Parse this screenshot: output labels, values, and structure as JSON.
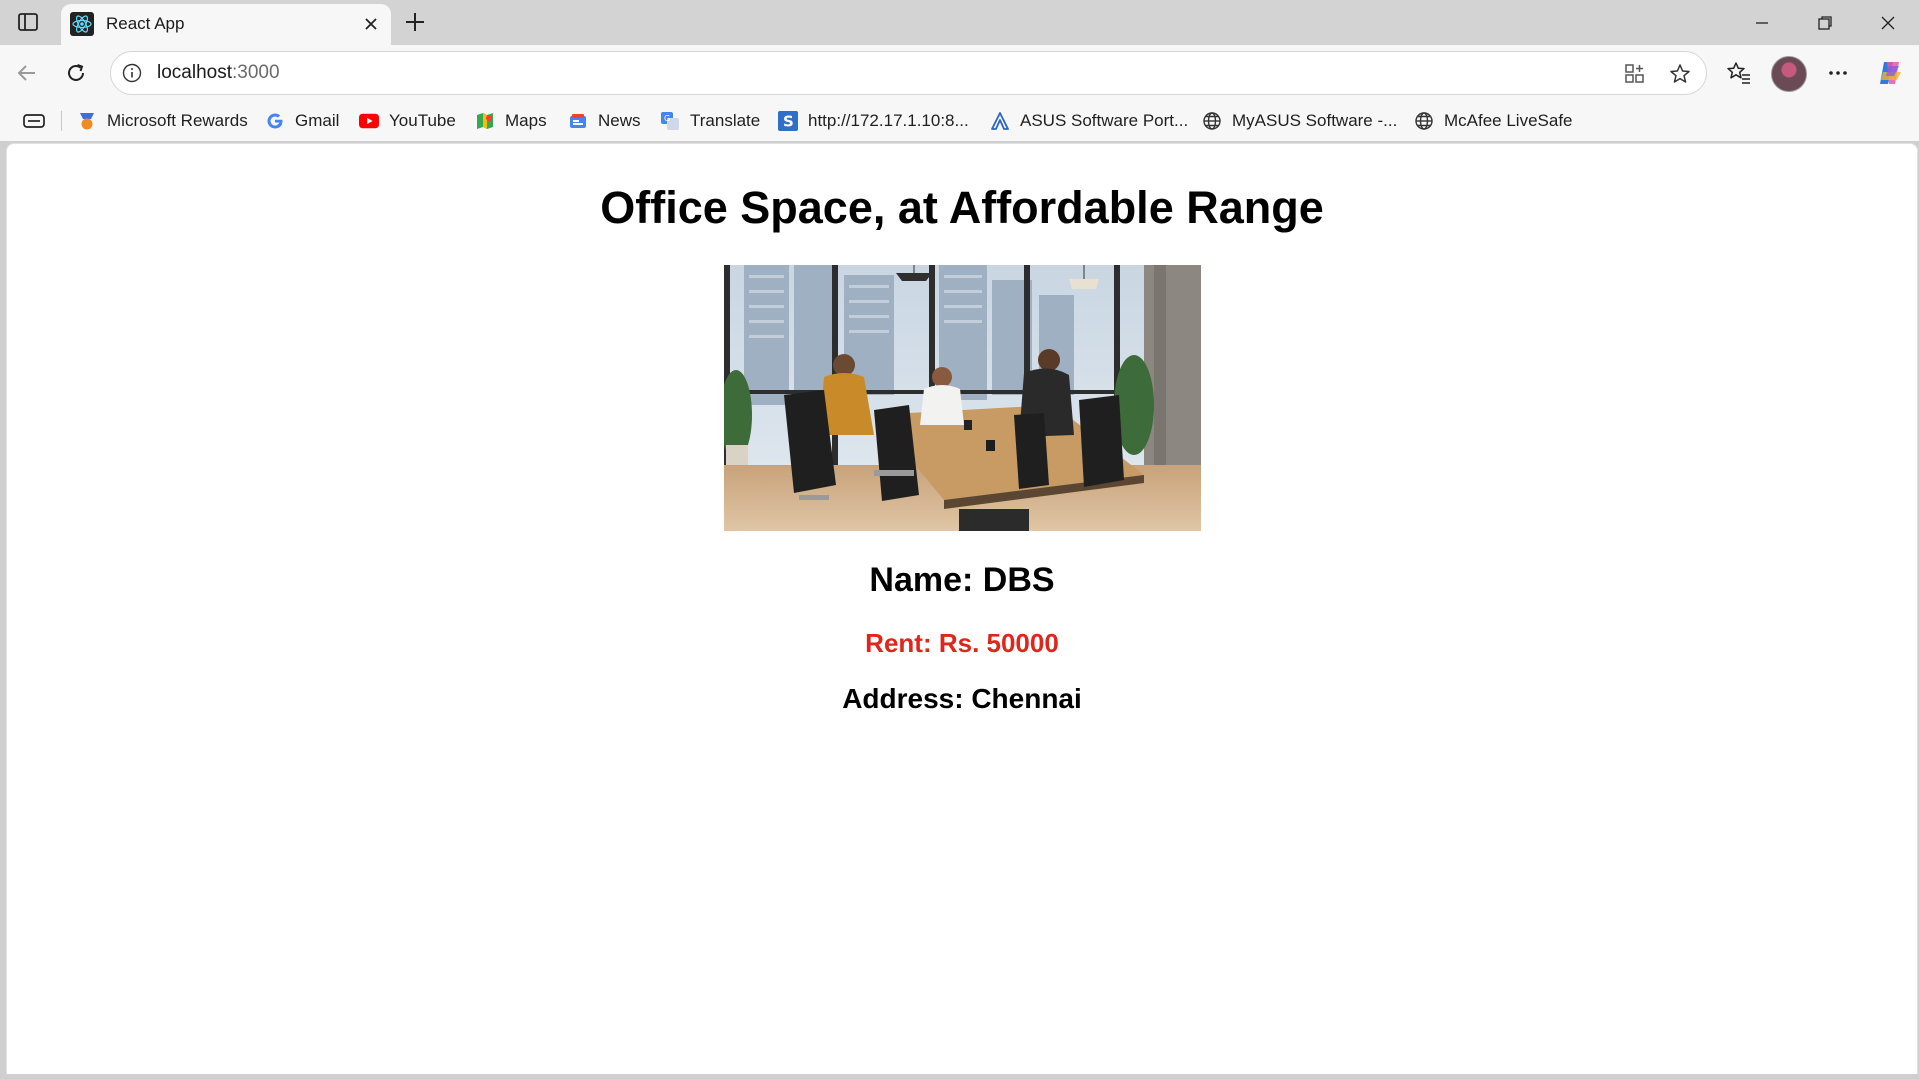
{
  "browser": {
    "tab": {
      "title": "React App"
    },
    "address": {
      "host": "localhost",
      "port": ":3000"
    },
    "bookmarks": [
      {
        "label": "Microsoft Rewards",
        "icon": "rewards-icon"
      },
      {
        "label": "Gmail",
        "icon": "google-icon"
      },
      {
        "label": "YouTube",
        "icon": "youtube-icon"
      },
      {
        "label": "Maps",
        "icon": "maps-icon"
      },
      {
        "label": "News",
        "icon": "news-icon"
      },
      {
        "label": "Translate",
        "icon": "translate-icon"
      },
      {
        "label": "http://172.17.1.10:8...",
        "icon": "s-icon"
      },
      {
        "label": "ASUS Software Port...",
        "icon": "asus-icon"
      },
      {
        "label": "MyASUS Software -...",
        "icon": "globe-icon"
      },
      {
        "label": "McAfee LiveSafe",
        "icon": "globe-icon"
      }
    ]
  },
  "page": {
    "heading": "Office Space, at Affordable Range",
    "office": {
      "name_line": "Name: DBS",
      "rent_line": "Rent: Rs. 50000",
      "address_line": "Address: Chennai",
      "rent_color": "#e0261c"
    },
    "image": {
      "subject": "office meeting room with three people at a table"
    }
  }
}
